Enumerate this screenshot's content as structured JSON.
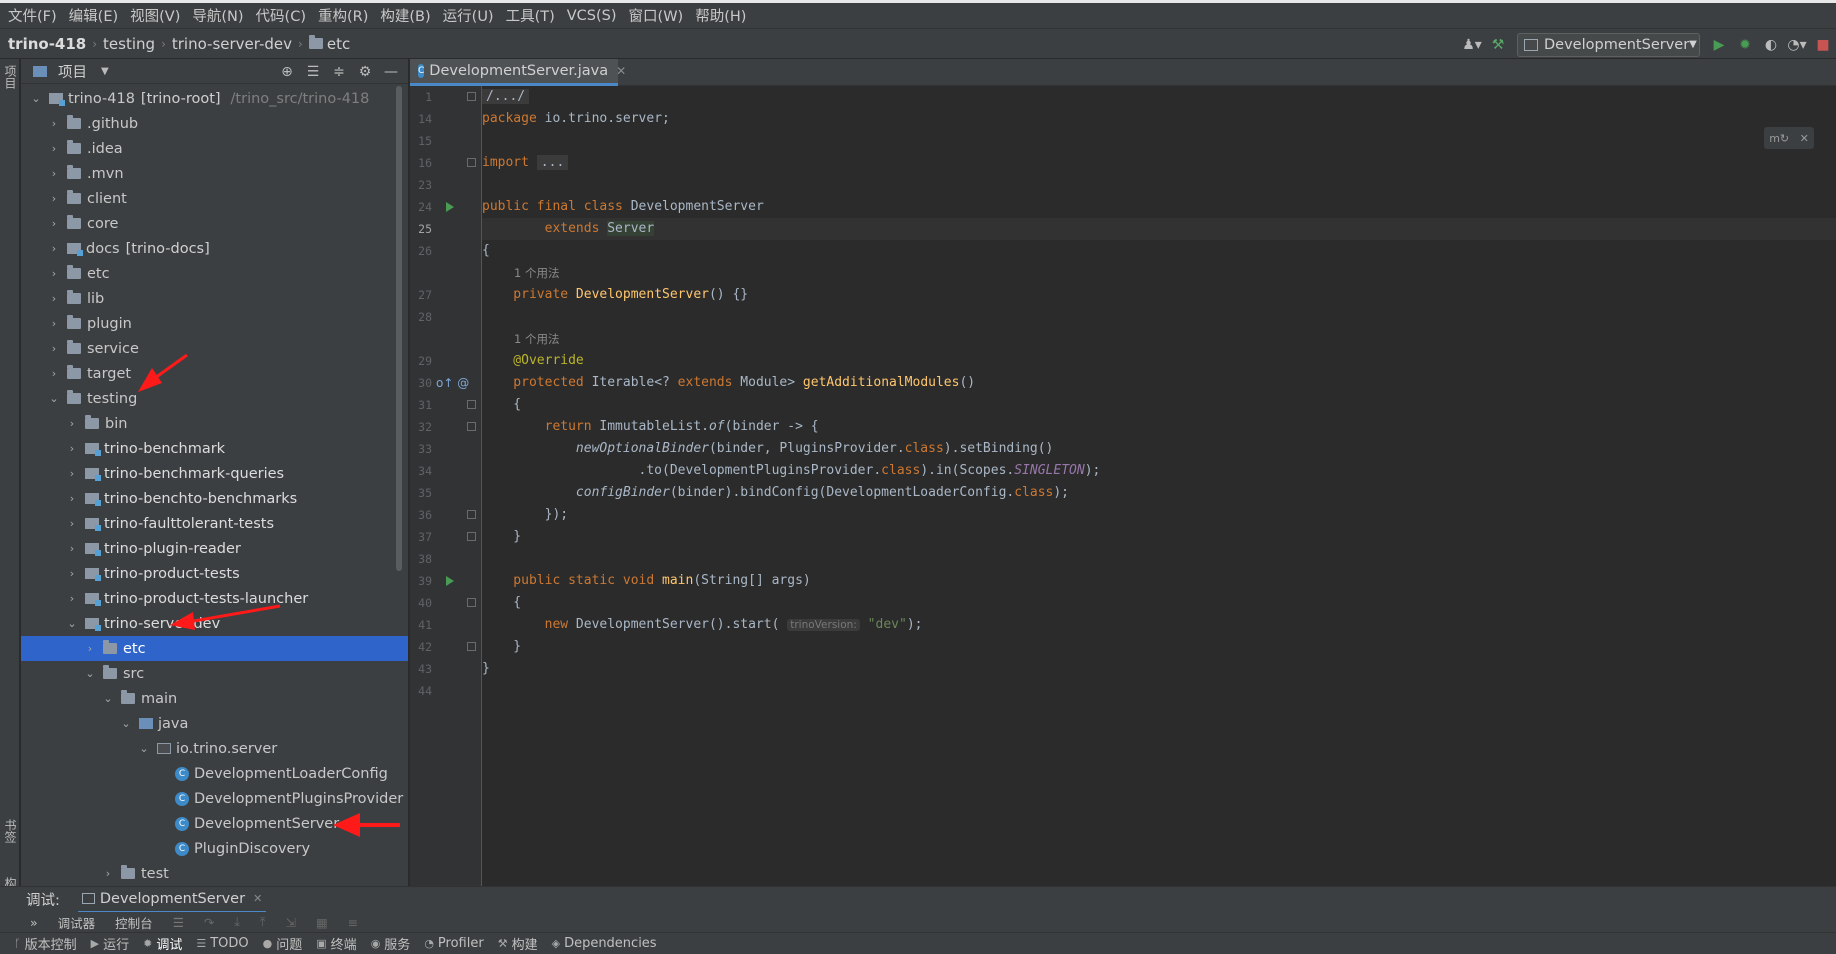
{
  "menu": [
    "文件(F)",
    "编辑(E)",
    "视图(V)",
    "导航(N)",
    "代码(C)",
    "重构(R)",
    "构建(B)",
    "运行(U)",
    "工具(T)",
    "VCS(S)",
    "窗口(W)",
    "帮助(H)"
  ],
  "breadcrumb": {
    "project": "trino-418",
    "folder1": "testing",
    "module": "trino-server-dev",
    "folder2": "etc"
  },
  "run_config": {
    "name": "DevelopmentServer"
  },
  "left_strip": {
    "project": "项目",
    "bookmarks": "书签",
    "structure": "结构"
  },
  "project_panel": {
    "title": "项目"
  },
  "tree": [
    {
      "label": "trino-418",
      "extra": "[trino-root]",
      "path": "/trino_src/trino-418",
      "level": 0,
      "expanded": true,
      "kind": "module"
    },
    {
      "label": ".github",
      "level": 1,
      "expanded": false,
      "kind": "folder"
    },
    {
      "label": ".idea",
      "level": 1,
      "expanded": false,
      "kind": "folder"
    },
    {
      "label": ".mvn",
      "level": 1,
      "expanded": false,
      "kind": "folder"
    },
    {
      "label": "client",
      "level": 1,
      "expanded": false,
      "kind": "folder"
    },
    {
      "label": "core",
      "level": 1,
      "expanded": false,
      "kind": "folder"
    },
    {
      "label": "docs",
      "extra": "[trino-docs]",
      "level": 1,
      "expanded": false,
      "kind": "module"
    },
    {
      "label": "etc",
      "level": 1,
      "expanded": false,
      "kind": "folder"
    },
    {
      "label": "lib",
      "level": 1,
      "expanded": false,
      "kind": "folder"
    },
    {
      "label": "plugin",
      "level": 1,
      "expanded": false,
      "kind": "folder"
    },
    {
      "label": "service",
      "level": 1,
      "expanded": false,
      "kind": "folder"
    },
    {
      "label": "target",
      "level": 1,
      "expanded": false,
      "kind": "folder"
    },
    {
      "label": "testing",
      "level": 1,
      "expanded": true,
      "kind": "folder"
    },
    {
      "label": "bin",
      "level": 2,
      "expanded": false,
      "kind": "folder"
    },
    {
      "label": "trino-benchmark",
      "level": 2,
      "expanded": false,
      "kind": "module",
      "bold": true
    },
    {
      "label": "trino-benchmark-queries",
      "level": 2,
      "expanded": false,
      "kind": "module",
      "bold": true
    },
    {
      "label": "trino-benchto-benchmarks",
      "level": 2,
      "expanded": false,
      "kind": "module",
      "bold": true
    },
    {
      "label": "trino-faulttolerant-tests",
      "level": 2,
      "expanded": false,
      "kind": "module",
      "bold": true
    },
    {
      "label": "trino-plugin-reader",
      "level": 2,
      "expanded": false,
      "kind": "module",
      "bold": true
    },
    {
      "label": "trino-product-tests",
      "level": 2,
      "expanded": false,
      "kind": "module",
      "bold": true
    },
    {
      "label": "trino-product-tests-launcher",
      "level": 2,
      "expanded": false,
      "kind": "module",
      "bold": true
    },
    {
      "label": "trino-server-dev",
      "level": 2,
      "expanded": true,
      "kind": "module",
      "bold": true
    },
    {
      "label": "etc",
      "level": 3,
      "expanded": false,
      "kind": "folder",
      "selected": true
    },
    {
      "label": "src",
      "level": 3,
      "expanded": true,
      "kind": "folder"
    },
    {
      "label": "main",
      "level": 4,
      "expanded": true,
      "kind": "folder"
    },
    {
      "label": "java",
      "level": 5,
      "expanded": true,
      "kind": "src"
    },
    {
      "label": "io.trino.server",
      "level": 6,
      "expanded": true,
      "kind": "package"
    },
    {
      "label": "DevelopmentLoaderConfig",
      "level": 7,
      "kind": "class"
    },
    {
      "label": "DevelopmentPluginsProvider",
      "level": 7,
      "kind": "class"
    },
    {
      "label": "DevelopmentServer",
      "level": 7,
      "kind": "class"
    },
    {
      "label": "PluginDiscovery",
      "level": 7,
      "kind": "class"
    },
    {
      "label": "test",
      "level": 4,
      "expanded": false,
      "kind": "folder"
    }
  ],
  "editor": {
    "tab": "DevelopmentServer.java",
    "line_numbers": [
      "1",
      "14",
      "15",
      "16",
      "23",
      "24",
      "25",
      "26",
      "",
      "27",
      "28",
      "",
      "29",
      "30",
      "31",
      "32",
      "33",
      "34",
      "35",
      "36",
      "37",
      "38",
      "39",
      "40",
      "41",
      "42",
      "43",
      "44"
    ],
    "usage_hint": "1 个用法",
    "inlay_param": "trinoVersion:"
  },
  "debug": {
    "label": "调试:",
    "tab": "DevelopmentServer",
    "sub_debugger": "调试器",
    "sub_console": "控制台"
  },
  "statusbar": [
    "版本控制",
    "运行",
    "调试",
    "TODO",
    "问题",
    "终端",
    "服务",
    "Profiler",
    "构建",
    "Dependencies"
  ],
  "colors": {
    "accent": "#2f65ca",
    "bg": "#2b2b2b",
    "panel": "#3c3f41",
    "arrow": "#ff1a1a"
  }
}
